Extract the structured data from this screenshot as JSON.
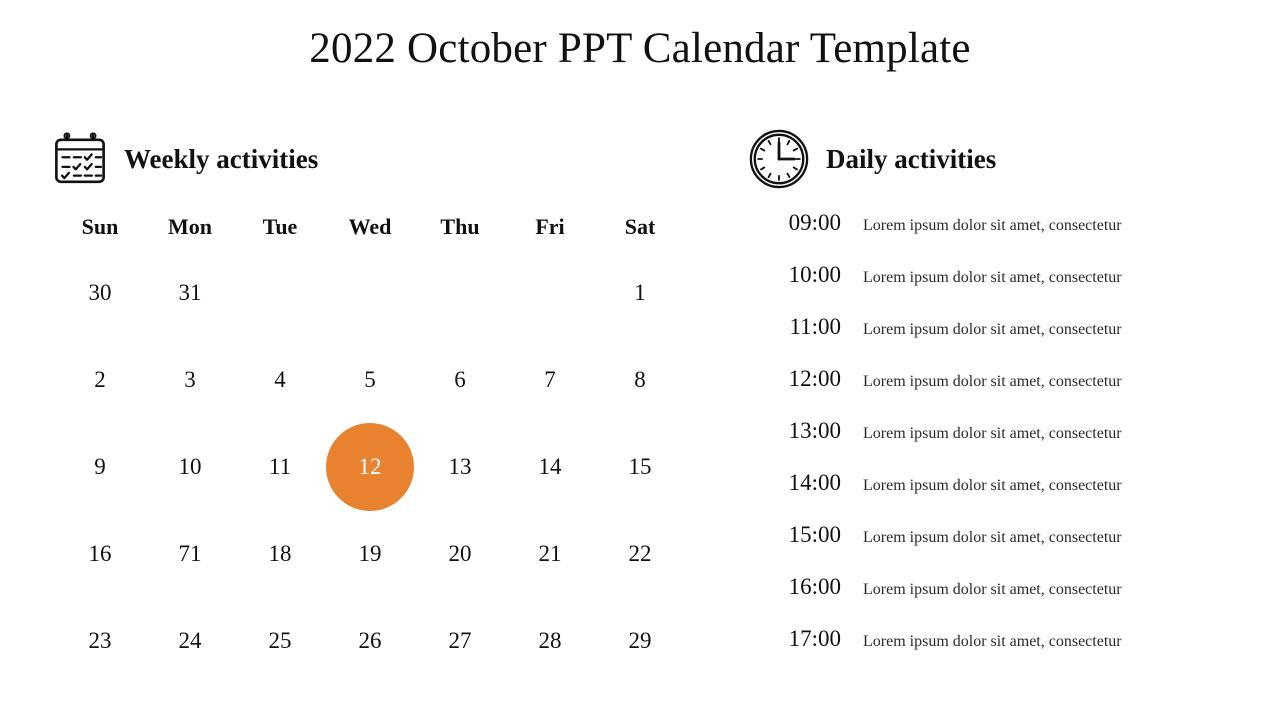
{
  "slide": {
    "title": "2022 October PPT Calendar Template",
    "background_color": "#ffffff",
    "accent_color": "#e8822f"
  },
  "weekly": {
    "icon": "calendar-checklist-icon",
    "heading": "Weekly activities",
    "weekday_headers": [
      "Sun",
      "Mon",
      "Tue",
      "Wed",
      "Thu",
      "Fri",
      "Sat"
    ],
    "weeks": [
      [
        "30",
        "31",
        "",
        "",
        "",
        "",
        "1"
      ],
      [
        "2",
        "3",
        "4",
        "5",
        "6",
        "7",
        "8"
      ],
      [
        "9",
        "10",
        "11",
        "12",
        "13",
        "14",
        "15"
      ],
      [
        "16",
        "71",
        "18",
        "19",
        "20",
        "21",
        "22"
      ],
      [
        "23",
        "24",
        "25",
        "26",
        "27",
        "28",
        "29"
      ]
    ],
    "highlighted_day": "12",
    "highlight_row": 2,
    "highlight_col": 3,
    "highlight_color": "#e8822f",
    "highlight_text_color": "#ffffff"
  },
  "daily": {
    "icon": "clock-icon",
    "heading": "Daily activities",
    "rows": [
      {
        "time": "09:00",
        "description": "Lorem ipsum dolor sit amet, consectetur"
      },
      {
        "time": "10:00",
        "description": "Lorem ipsum dolor sit amet, consectetur"
      },
      {
        "time": "11:00",
        "description": "Lorem ipsum dolor sit amet, consectetur"
      },
      {
        "time": "12:00",
        "description": "Lorem ipsum dolor sit amet, consectetur"
      },
      {
        "time": "13:00",
        "description": "Lorem ipsum dolor sit amet, consectetur"
      },
      {
        "time": "14:00",
        "description": "Lorem ipsum dolor sit amet, consectetur"
      },
      {
        "time": "15:00",
        "description": "Lorem ipsum dolor sit amet, consectetur"
      },
      {
        "time": "16:00",
        "description": "Lorem ipsum dolor sit amet, consectetur"
      },
      {
        "time": "17:00",
        "description": "Lorem ipsum dolor sit amet, consectetur"
      }
    ]
  }
}
